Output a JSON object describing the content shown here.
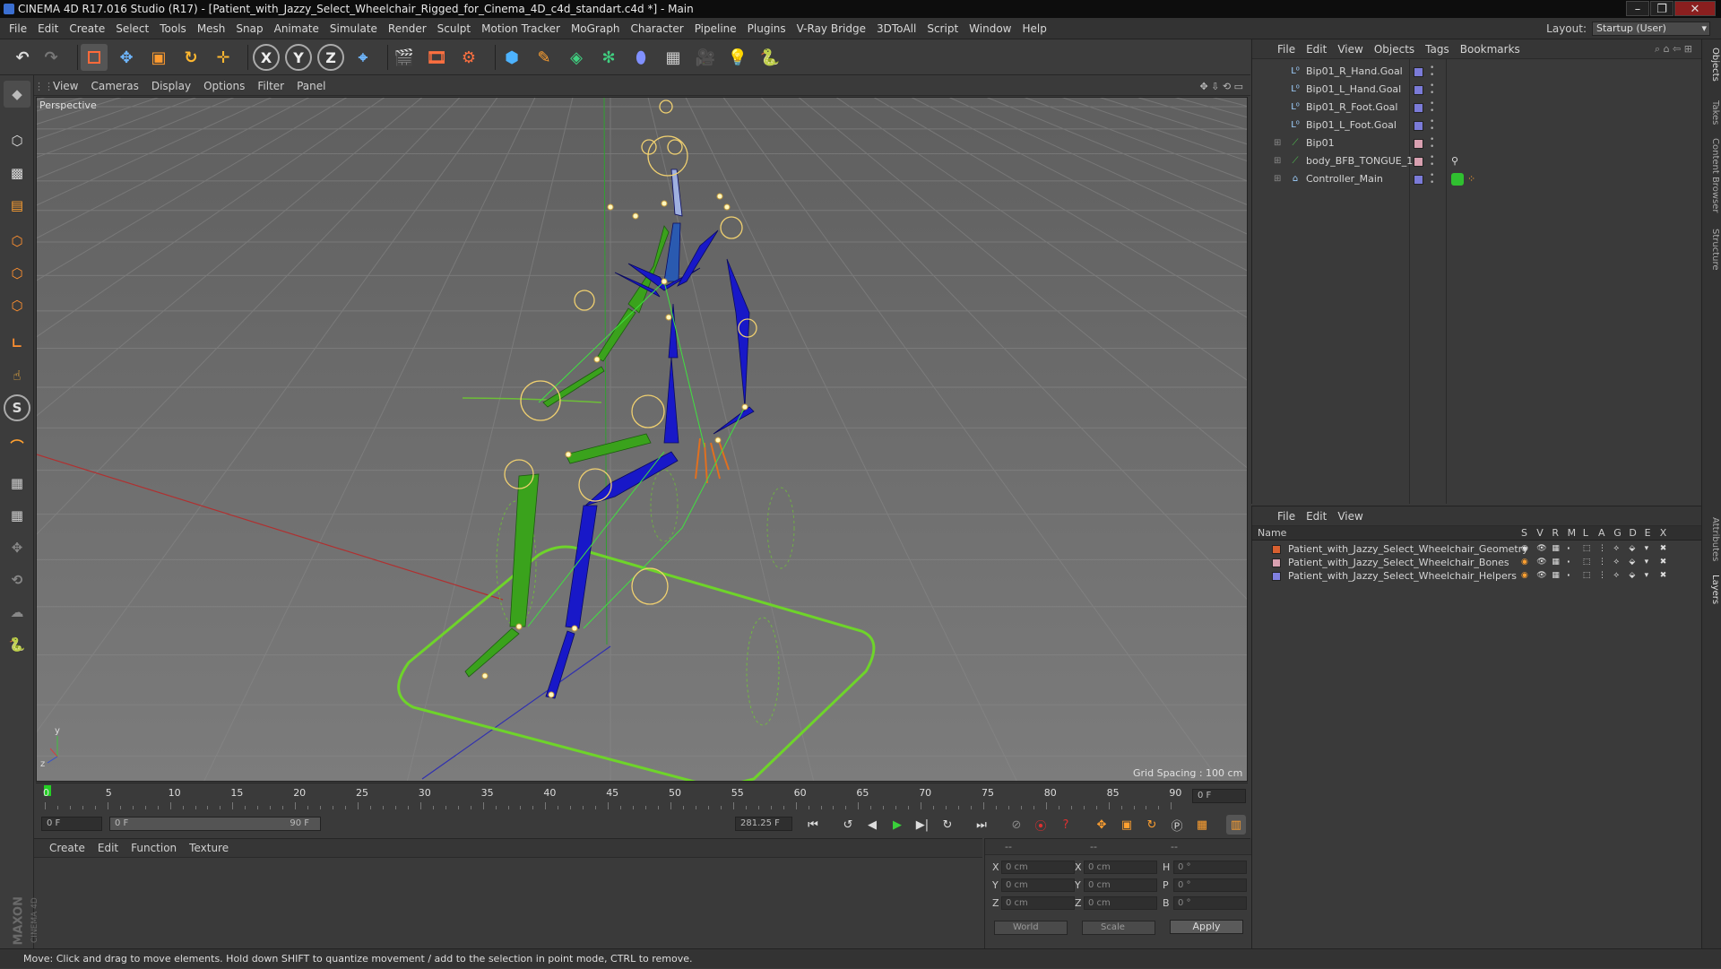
{
  "window": {
    "title": "CINEMA 4D R17.016 Studio (R17) - [Patient_with_Jazzy_Select_Wheelchair_Rigged_for_Cinema_4D_c4d_standart.c4d *] - Main",
    "controls": [
      "minimize",
      "maximize",
      "close"
    ]
  },
  "menubar": {
    "items": [
      "File",
      "Edit",
      "Create",
      "Select",
      "Tools",
      "Mesh",
      "Snap",
      "Animate",
      "Simulate",
      "Render",
      "Sculpt",
      "Motion Tracker",
      "MoGraph",
      "Character",
      "Pipeline",
      "Plugins",
      "V-Ray Bridge",
      "3DToAll",
      "Script",
      "Window",
      "Help"
    ],
    "layout_label": "Layout:",
    "layout_value": "Startup (User)"
  },
  "toolbar": {
    "icons": [
      "undo-icon",
      "redo-icon",
      "live-selection-icon",
      "move-icon",
      "scale-icon",
      "rotate-icon",
      "recent-tool-icon",
      "x-axis-icon",
      "y-axis-icon",
      "z-axis-icon",
      "world-coordinate-icon",
      "render-view-icon",
      "render-picture-viewer-icon",
      "edit-render-settings-icon",
      "cube-icon",
      "pen-spline-icon",
      "subdivision-surface-icon",
      "array-icon",
      "deformer-icon",
      "floor-icon",
      "camera-icon",
      "light-icon",
      "python-icon"
    ]
  },
  "viewport": {
    "menu": [
      "View",
      "Cameras",
      "Display",
      "Options",
      "Filter",
      "Panel"
    ],
    "label": "Perspective",
    "grid_spacing": "Grid Spacing : 100 cm",
    "axis_y": "y",
    "axis_z": "z"
  },
  "timeline": {
    "ticks": [
      "0",
      "5",
      "10",
      "15",
      "20",
      "25",
      "30",
      "35",
      "40",
      "45",
      "50",
      "55",
      "60",
      "65",
      "70",
      "75",
      "80",
      "85",
      "90"
    ],
    "current_frame": "0 F"
  },
  "playback": {
    "start_field": "0 F",
    "range_start": "0 F",
    "range_end": "90 F",
    "end_field": "281.25 F"
  },
  "material_panel": {
    "menu": [
      "Create",
      "Edit",
      "Function",
      "Texture"
    ]
  },
  "coordinates": {
    "dashes": [
      "--",
      "--",
      "--"
    ],
    "rows": [
      {
        "a": "X",
        "a_val": "0 cm",
        "b": "X",
        "b_val": "0 cm",
        "c": "H",
        "c_val": "0 °"
      },
      {
        "a": "Y",
        "a_val": "0 cm",
        "b": "Y",
        "b_val": "0 cm",
        "c": "P",
        "c_val": "0 °"
      },
      {
        "a": "Z",
        "a_val": "0 cm",
        "b": "Z",
        "b_val": "0 cm",
        "c": "B",
        "c_val": "0 °"
      }
    ],
    "world": "World",
    "scale": "Scale",
    "apply": "Apply"
  },
  "object_manager": {
    "menu": [
      "File",
      "Edit",
      "View",
      "Objects",
      "Tags",
      "Bookmarks"
    ],
    "objects": [
      {
        "name": "Bip01_R_Hand.Goal",
        "icon": "null-icon",
        "color": "#7b7bd8"
      },
      {
        "name": "Bip01_L_Hand.Goal",
        "icon": "null-icon",
        "color": "#7b7bd8"
      },
      {
        "name": "Bip01_R_Foot.Goal",
        "icon": "null-icon",
        "color": "#7b7bd8"
      },
      {
        "name": "Bip01_L_Foot.Goal",
        "icon": "null-icon",
        "color": "#7b7bd8"
      },
      {
        "name": "Bip01",
        "icon": "bone-icon",
        "color": "#d8a0b0"
      },
      {
        "name": "body_BFB_TONGUE_1",
        "icon": "bone-icon",
        "color": "#d8a0b0"
      },
      {
        "name": "Controller_Main",
        "icon": "joint-icon",
        "color": "#7b7bd8"
      }
    ]
  },
  "layer_manager": {
    "menu": [
      "File",
      "Edit",
      "View"
    ],
    "columns": [
      "Name",
      "S",
      "V",
      "R",
      "M",
      "L",
      "A",
      "G",
      "D",
      "E",
      "X"
    ],
    "layers": [
      {
        "name": "Patient_with_Jazzy_Select_Wheelchair_Geometry",
        "color": "#d86030"
      },
      {
        "name": "Patient_with_Jazzy_Select_Wheelchair_Bones",
        "color": "#d8a0b0"
      },
      {
        "name": "Patient_with_Jazzy_Select_Wheelchair_Helpers",
        "color": "#8080e0"
      }
    ]
  },
  "side_tabs": [
    "Objects",
    "Takes",
    "Content Browser",
    "Structure",
    "Attributes",
    "Layers"
  ],
  "status": "Move: Click and drag to move elements. Hold down SHIFT to quantize movement / add to the selection in point mode, CTRL to remove.",
  "brand": {
    "line1": "MAXON",
    "line2": "CINEMA 4D"
  }
}
